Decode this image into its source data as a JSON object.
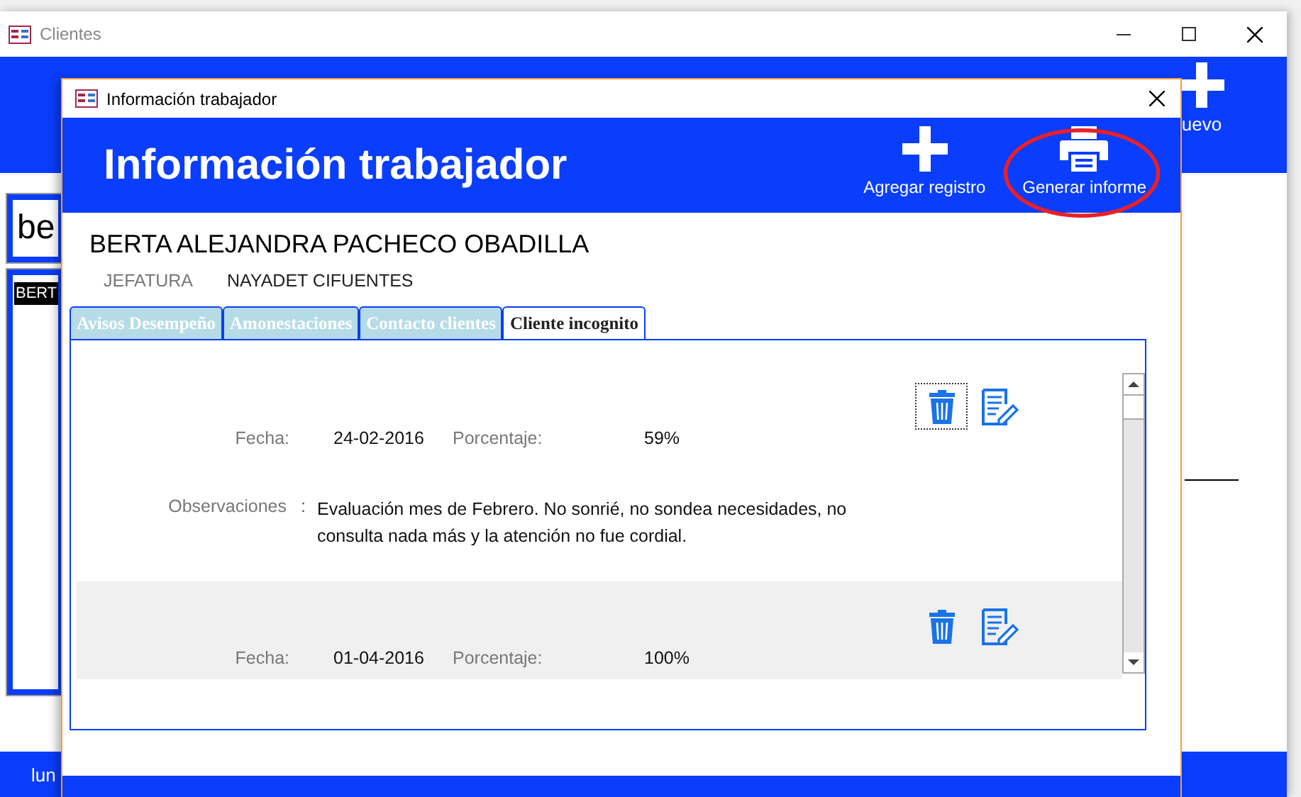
{
  "background_window": {
    "title": "Clientes",
    "header_button": "uevo",
    "search": {
      "value": "be"
    },
    "list": [
      {
        "label": "BERT",
        "selected": true
      }
    ],
    "footer": "lun"
  },
  "dialog": {
    "title": "Información trabajador",
    "header_title": "Información trabajador",
    "actions": [
      {
        "label": "Agregar registro",
        "kind": "add",
        "highlighted": false
      },
      {
        "label": "Generar informe",
        "kind": "print",
        "highlighted": true
      }
    ],
    "worker_name": "BERTA ALEJANDRA PACHECO OBADILLA",
    "role_label": "JEFATURA",
    "role_value": "NAYADET CIFUENTES",
    "tabs": [
      {
        "label": "Avisos Desempeño",
        "selected": false
      },
      {
        "label": "Amonestaciones",
        "selected": false
      },
      {
        "label": "Contacto clientes",
        "selected": false
      },
      {
        "label": "Cliente incognito",
        "selected": true
      }
    ],
    "records": [
      {
        "date_label": "Fecha:",
        "date": "24-02-2016",
        "percent_label": "Porcentaje:",
        "percent": "59%",
        "notes_label": "Observaciones",
        "notes_separator": ":",
        "notes": "Evaluación mes de Febrero. No sonrié, no sondea necesidades, no consulta nada más y la atención no fue cordial.",
        "focused": true
      },
      {
        "date_label": "Fecha:",
        "date": "01-04-2016",
        "percent_label": "Porcentaje:",
        "percent": "100%",
        "focused": false
      }
    ]
  }
}
